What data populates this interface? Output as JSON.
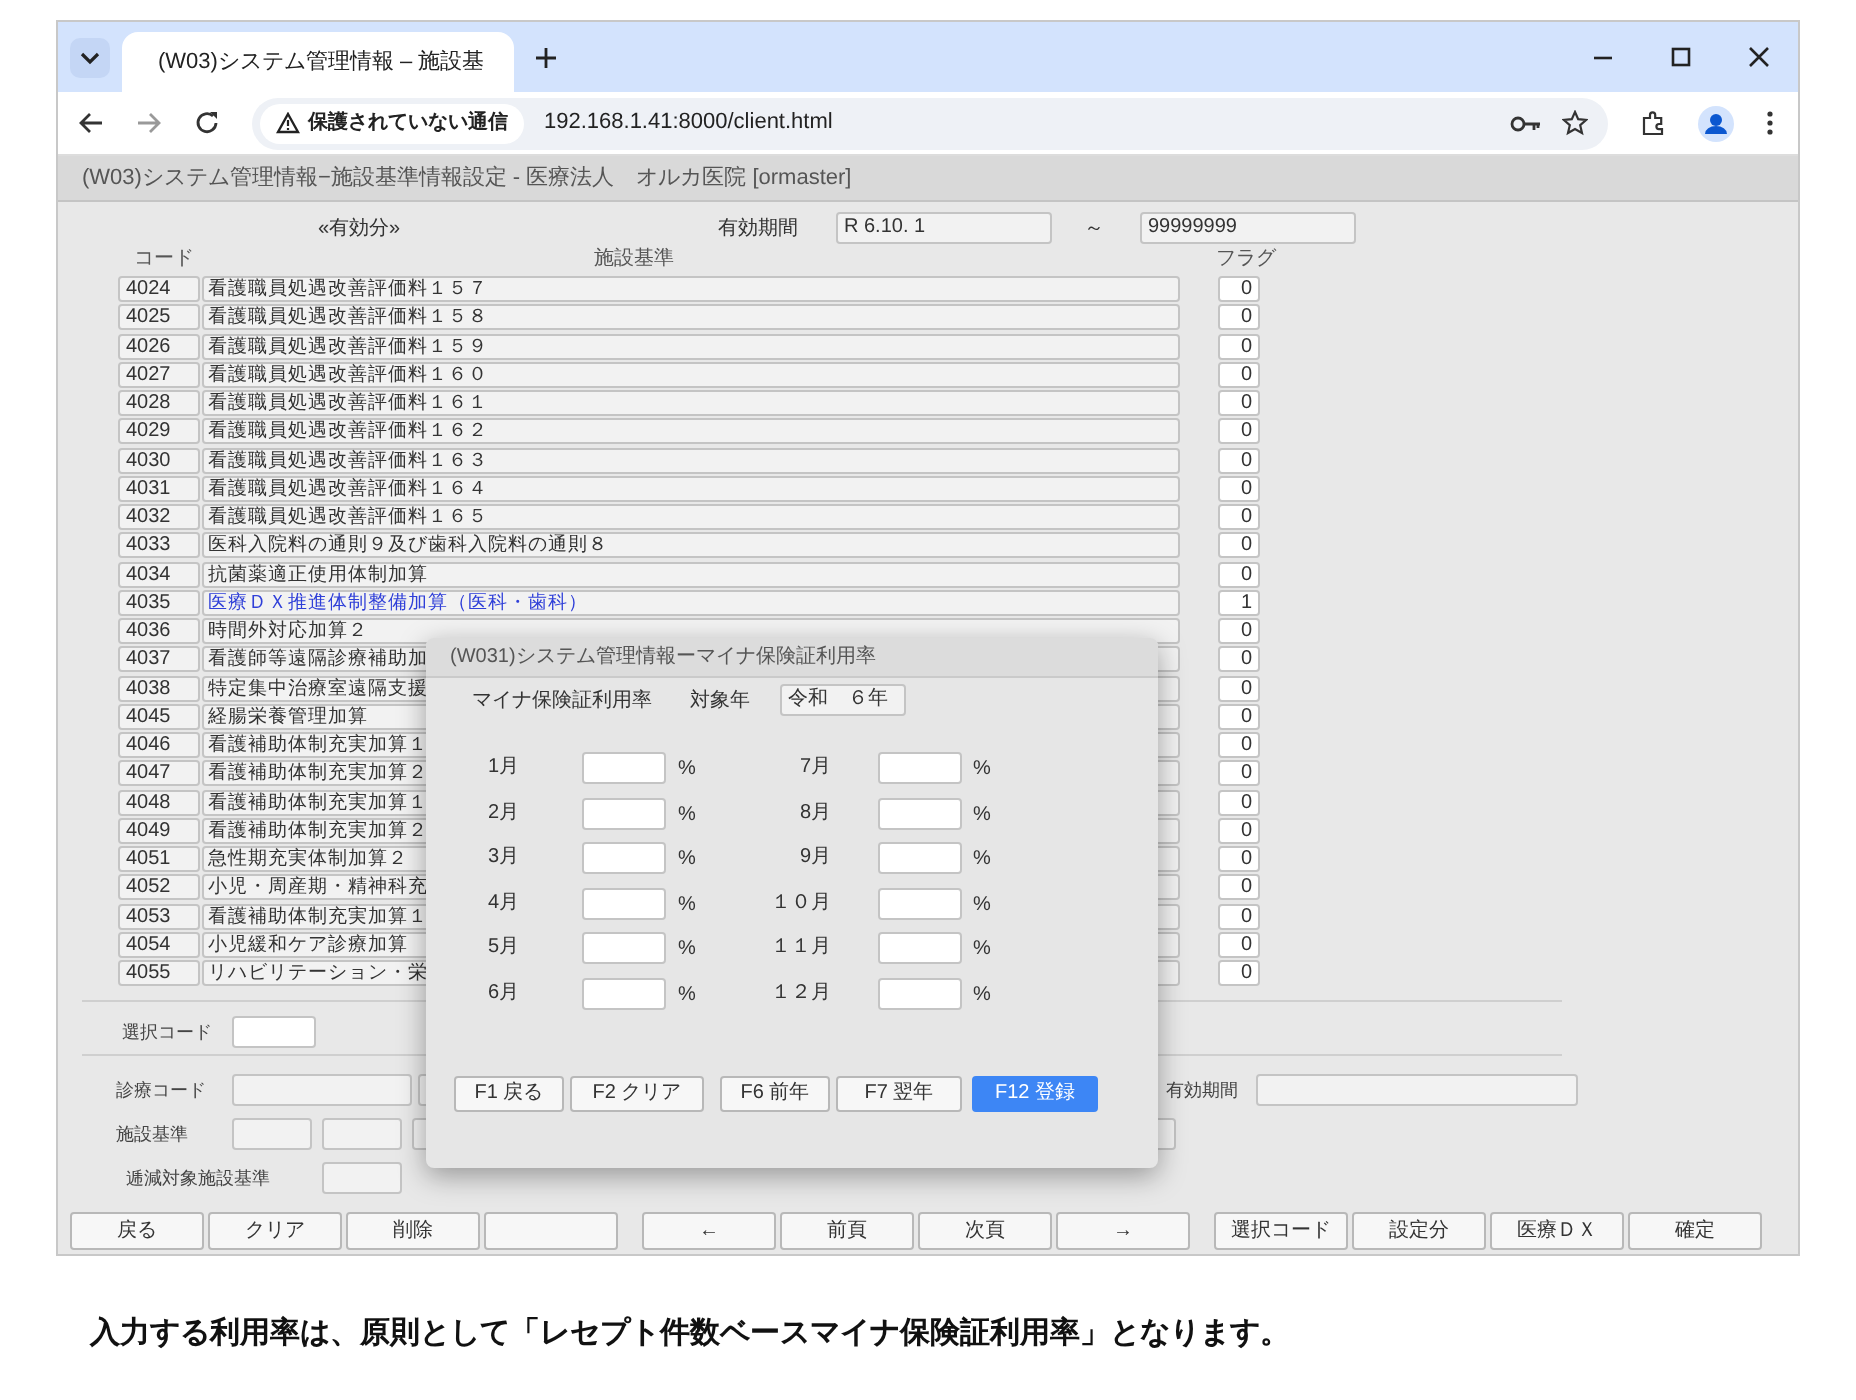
{
  "browser": {
    "tab": {
      "title": "(W03)システム管理情報 – 施設基",
      "selected": true
    },
    "security_label": "保護されていない通信",
    "url": "192.168.1.41:8000/client.html"
  },
  "app": {
    "title": "(W03)システム管理情報−施設基準情報設定 - 医療法人　オルカ医院 [ormaster]",
    "filter_label": "«有効分»",
    "period_label": "有効期間",
    "period_from": "R 6.10. 1",
    "period_sep": "～",
    "period_to": "99999999",
    "columns": [
      "コード",
      "施設基準",
      "フラグ"
    ],
    "rows": [
      {
        "code": "4024",
        "name": "看護職員処遇改善評価料１５７",
        "flag": "0",
        "highlighted": false
      },
      {
        "code": "4025",
        "name": "看護職員処遇改善評価料１５８",
        "flag": "0",
        "highlighted": false
      },
      {
        "code": "4026",
        "name": "看護職員処遇改善評価料１５９",
        "flag": "0",
        "highlighted": false
      },
      {
        "code": "4027",
        "name": "看護職員処遇改善評価料１６０",
        "flag": "0",
        "highlighted": false
      },
      {
        "code": "4028",
        "name": "看護職員処遇改善評価料１６１",
        "flag": "0",
        "highlighted": false
      },
      {
        "code": "4029",
        "name": "看護職員処遇改善評価料１６２",
        "flag": "0",
        "highlighted": false
      },
      {
        "code": "4030",
        "name": "看護職員処遇改善評価料１６３",
        "flag": "0",
        "highlighted": false
      },
      {
        "code": "4031",
        "name": "看護職員処遇改善評価料１６４",
        "flag": "0",
        "highlighted": false
      },
      {
        "code": "4032",
        "name": "看護職員処遇改善評価料１６５",
        "flag": "0",
        "highlighted": false
      },
      {
        "code": "4033",
        "name": "医科入院料の通則９及び歯科入院料の通則８",
        "flag": "0",
        "highlighted": false
      },
      {
        "code": "4034",
        "name": "抗菌薬適正使用体制加算",
        "flag": "0",
        "highlighted": false
      },
      {
        "code": "4035",
        "name": "医療ＤＸ推進体制整備加算（医科・歯科）",
        "flag": "1",
        "highlighted": true
      },
      {
        "code": "4036",
        "name": "時間外対応加算２",
        "flag": "0",
        "highlighted": false
      },
      {
        "code": "4037",
        "name": "看護師等遠隔診療補助加",
        "flag": "0",
        "highlighted": false
      },
      {
        "code": "4038",
        "name": "特定集中治療室遠隔支援",
        "flag": "0",
        "highlighted": false
      },
      {
        "code": "4045",
        "name": "経腸栄養管理加算",
        "flag": "0",
        "highlighted": false
      },
      {
        "code": "4046",
        "name": "看護補助体制充実加算１",
        "flag": "0",
        "highlighted": false
      },
      {
        "code": "4047",
        "name": "看護補助体制充実加算２",
        "flag": "0",
        "highlighted": false
      },
      {
        "code": "4048",
        "name": "看護補助体制充実加算１",
        "flag": "0",
        "highlighted": false
      },
      {
        "code": "4049",
        "name": "看護補助体制充実加算２",
        "flag": "0",
        "highlighted": false
      },
      {
        "code": "4051",
        "name": "急性期充実体制加算２",
        "flag": "0",
        "highlighted": false
      },
      {
        "code": "4052",
        "name": "小児・周産期・精神科充",
        "flag": "0",
        "highlighted": false
      },
      {
        "code": "4053",
        "name": "看護補助体制充実加算１",
        "flag": "0",
        "highlighted": false
      },
      {
        "code": "4054",
        "name": "小児緩和ケア診療加算",
        "flag": "0",
        "highlighted": false
      },
      {
        "code": "4055",
        "name": "リハビリテーション・栄",
        "flag": "0",
        "highlighted": false
      }
    ],
    "form": {
      "select_code_label": "選択コード",
      "treatment_code_label": "診療コード",
      "period_label": "有効期間",
      "standard_label": "施設基準",
      "reduction_label": "逓減対象施設基準"
    },
    "footer_buttons": [
      {
        "kind": "label",
        "label": "戻る"
      },
      {
        "kind": "label",
        "label": "クリア"
      },
      {
        "kind": "label",
        "label": "削除"
      },
      {
        "kind": "blank"
      },
      {
        "kind": "label",
        "label": "←"
      },
      {
        "kind": "label",
        "label": "前頁"
      },
      {
        "kind": "label",
        "label": "次頁"
      },
      {
        "kind": "label",
        "label": "→"
      },
      {
        "kind": "label",
        "label": "選択コード"
      },
      {
        "kind": "label",
        "label": "設定分"
      },
      {
        "kind": "label",
        "label": "医療ＤＸ"
      },
      {
        "kind": "label",
        "label": "確定"
      }
    ]
  },
  "dialog": {
    "title": "(W031)システム管理情報ーマイナ保険証利用率",
    "heading": "マイナ保険証利用率",
    "year_label": "対象年",
    "year_value": "令和　６年",
    "unit": "%",
    "months": [
      {
        "label": "1月"
      },
      {
        "label": "2月"
      },
      {
        "label": "3月"
      },
      {
        "label": "4月"
      },
      {
        "label": "5月"
      },
      {
        "label": "6月"
      },
      {
        "label": "7月"
      },
      {
        "label": "8月"
      },
      {
        "label": "9月"
      },
      {
        "label": "１０月"
      },
      {
        "label": "１１月"
      },
      {
        "label": "１２月"
      }
    ],
    "buttons": [
      {
        "label": "F1 戻る",
        "primary": false
      },
      {
        "label": "F2 クリア",
        "primary": false
      },
      {
        "label": "F6 前年",
        "primary": false
      },
      {
        "label": "F7 翌年",
        "primary": false
      },
      {
        "label": "F12 登録",
        "primary": true
      }
    ]
  },
  "caption": "入力する利用率は、原則として「レセプト件数ベースマイナ保険証利用率」となります。"
}
